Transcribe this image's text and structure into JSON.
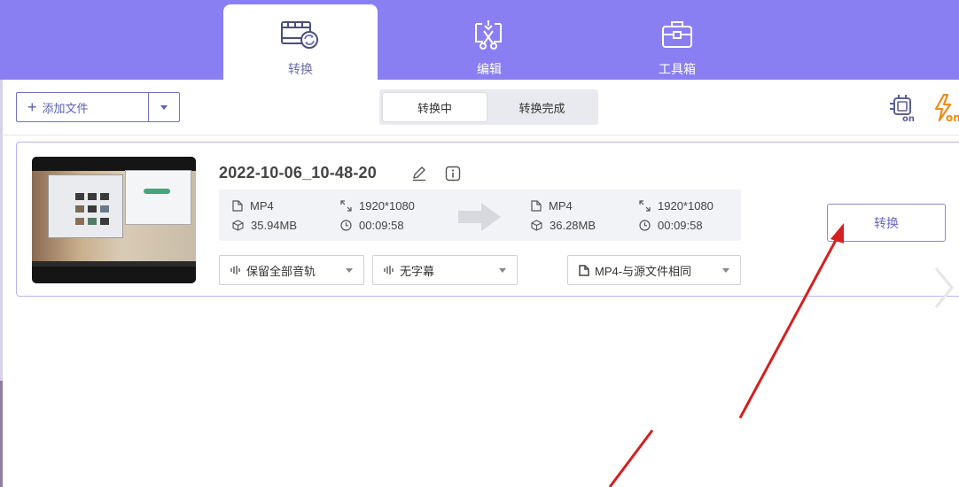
{
  "nav": {
    "tabs": [
      {
        "id": "convert",
        "label": "转换",
        "icon": "convert-film-icon",
        "active": true
      },
      {
        "id": "edit",
        "label": "编辑",
        "icon": "edit-scissors-icon",
        "active": false
      },
      {
        "id": "tools",
        "label": "工具箱",
        "icon": "toolbox-icon",
        "active": false
      }
    ]
  },
  "toolbar": {
    "add_file_label": "添加文件",
    "segments": [
      {
        "label": "转换中",
        "active": true
      },
      {
        "label": "转换完成",
        "active": false
      }
    ],
    "gpu_icon": "gpu-acceleration-on-icon",
    "speed_icon": "high-speed-on-icon"
  },
  "file": {
    "name": "2022-10-06_10-48-20",
    "source": {
      "format": "MP4",
      "resolution": "1920*1080",
      "size": "35.94MB",
      "duration": "00:09:58"
    },
    "target": {
      "format": "MP4",
      "resolution": "1920*1080",
      "size": "36.28MB",
      "duration": "00:09:58"
    },
    "audio_option": "保留全部音轨",
    "subtitle_option": "无字幕",
    "output_format_option": "MP4-与源文件相同",
    "convert_label": "转换"
  },
  "colors": {
    "nav_bg": "#8a7ff2",
    "accent": "#6b67c8",
    "annotation_arrow": "#d42020"
  }
}
